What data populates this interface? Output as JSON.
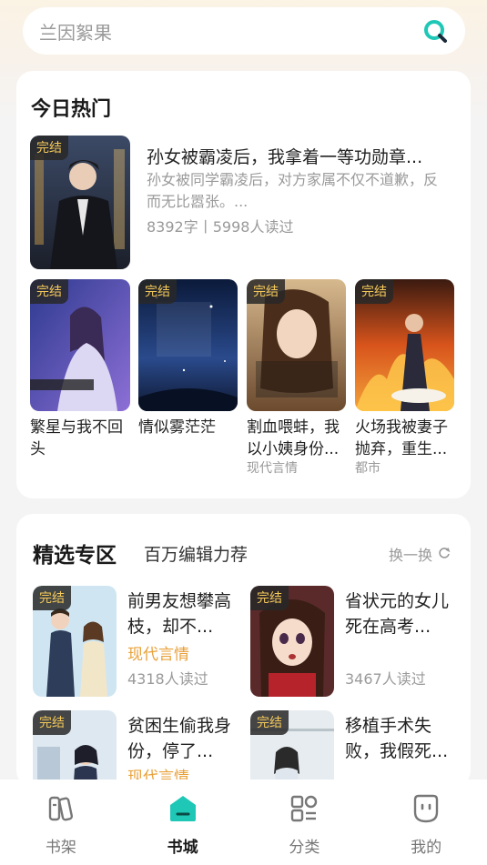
{
  "search": {
    "placeholder_text": "兰因絮果",
    "icon": "search-icon"
  },
  "hot": {
    "title": "今日热门",
    "badge": "完结",
    "lead": {
      "title": "孙女被霸凌后，我拿着一等功勋章...",
      "desc": "孙女被同学霸凌后，对方家属不仅不道歉，反而无比嚣张。...",
      "meta": "8392字丨5998人读过"
    },
    "grid": [
      {
        "title": "繁星与我不回头",
        "tag": ""
      },
      {
        "title": "情似雾茫茫",
        "tag": ""
      },
      {
        "title": "割血喂蚌，我以小姨身份...",
        "tag": "现代言情"
      },
      {
        "title": "火场我被妻子抛弃，重生...",
        "tag": "都市"
      }
    ]
  },
  "featured": {
    "title": "精选专区",
    "subtitle": "百万编辑力荐",
    "refresh_label": "换一换",
    "badge": "完结",
    "books": [
      {
        "title": "前男友想攀高枝，却不...",
        "genre": "现代言情",
        "meta": "4318人读过"
      },
      {
        "title": "省状元的女儿死在高考...",
        "genre": "",
        "meta": "3467人读过"
      },
      {
        "title": "贫困生偷我身份，停了...",
        "genre": "现代言情",
        "meta": ""
      },
      {
        "title": "移植手术失败，我假死...",
        "genre": "",
        "meta": ""
      }
    ]
  },
  "tabs": [
    {
      "label": "书架",
      "icon": "bookshelf-icon"
    },
    {
      "label": "书城",
      "icon": "bookstore-icon"
    },
    {
      "label": "分类",
      "icon": "category-icon"
    },
    {
      "label": "我的",
      "icon": "profile-icon"
    }
  ],
  "colors": {
    "accent": "#1fc7b6",
    "badge_text": "#f5c95a",
    "genre": "#e8a13a"
  }
}
